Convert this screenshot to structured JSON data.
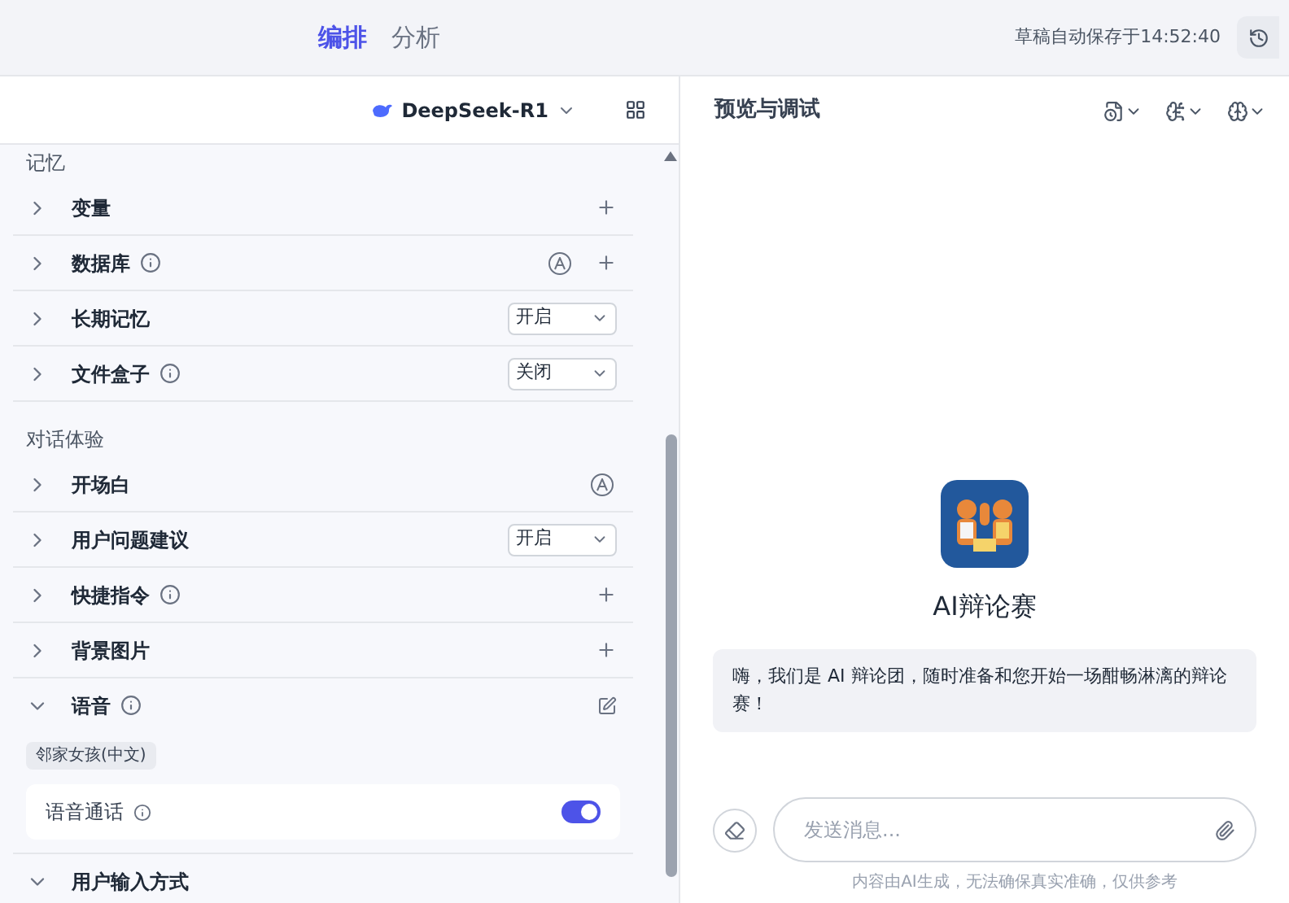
{
  "top_tabs": [
    {
      "label": "编排",
      "selected": true
    },
    {
      "label": "分析",
      "selected": false
    }
  ],
  "autosave": "草稿自动保存于14:52:40",
  "model": {
    "name": "DeepSeek-R1"
  },
  "sections": [
    {
      "title": "记忆",
      "rows": [
        {
          "label": "变量",
          "kind": "add",
          "info": false,
          "expanded": false
        },
        {
          "label": "数据库",
          "kind": "auto_add",
          "info": true,
          "expanded": false
        },
        {
          "label": "长期记忆",
          "kind": "select",
          "value": "开启",
          "info": false,
          "expanded": false
        },
        {
          "label": "文件盒子",
          "kind": "select",
          "value": "关闭",
          "info": true,
          "expanded": false
        }
      ]
    },
    {
      "title": "对话体验",
      "rows": [
        {
          "label": "开场白",
          "kind": "auto",
          "info": false,
          "expanded": false
        },
        {
          "label": "用户问题建议",
          "kind": "select",
          "value": "开启",
          "info": false,
          "expanded": false
        },
        {
          "label": "快捷指令",
          "kind": "add",
          "info": true,
          "expanded": false
        },
        {
          "label": "背景图片",
          "kind": "add",
          "info": false,
          "expanded": false
        },
        {
          "label": "语音",
          "kind": "edit",
          "info": true,
          "expanded": true,
          "tag": "邻家女孩(中文)",
          "setting": {
            "label": "语音通话",
            "info": true,
            "on": true
          }
        },
        {
          "label": "用户输入方式",
          "kind": "none",
          "info": false,
          "expanded": true
        }
      ]
    }
  ],
  "preview": {
    "title": "预览与调试",
    "bot_name": "AI辩论赛",
    "message": "嗨，我们是 AI 辩论团，随时准备和您开始一场酣畅淋漓的辩论赛！",
    "input_placeholder": "发送消息...",
    "disclaimer": "内容由AI生成，无法确保真实准确，仅供参考"
  }
}
